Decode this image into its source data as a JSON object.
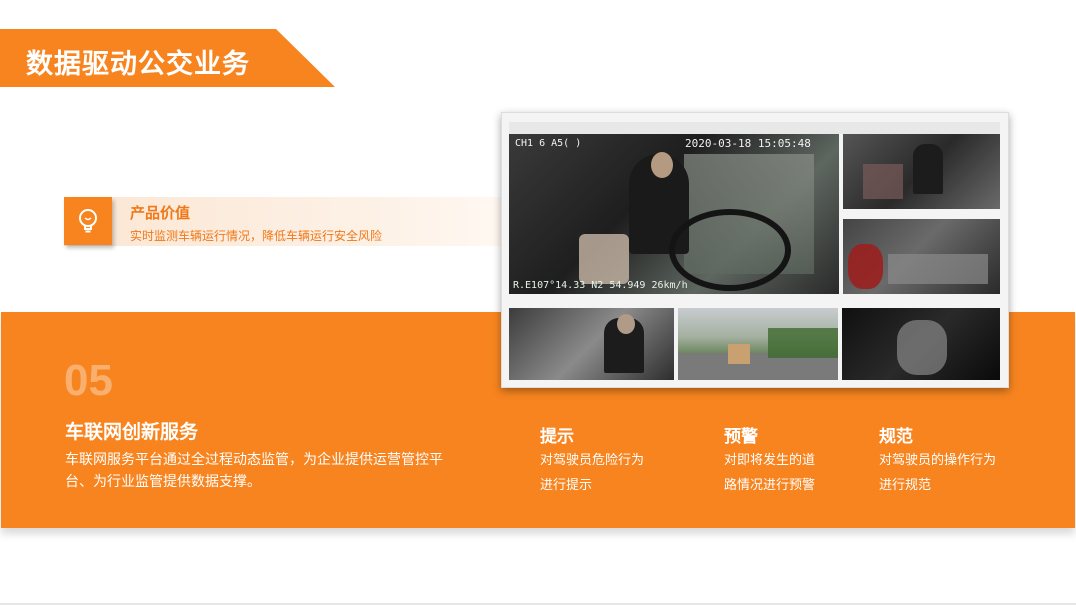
{
  "title": "数据驱动公交业务",
  "product_value": {
    "heading": "产品价值",
    "description": "实时监测车辆运行情况，降低车辆运行安全风险",
    "icon": "lightbulb-icon"
  },
  "service": {
    "number": "05",
    "title": "车联网创新服务",
    "description": "车联网服务平台通过全过程动态监管，为企业提供运营管控平台、为行业监管提供数据支撑。"
  },
  "features": [
    {
      "title": "提示",
      "lines": [
        "对驾驶员危险行为",
        "进行提示"
      ]
    },
    {
      "title": "预警",
      "lines": [
        "对即将发生的道",
        "路情况进行预警"
      ]
    },
    {
      "title": "规范",
      "lines": [
        "对驾驶员的操作行为",
        "进行规范"
      ]
    }
  ],
  "monitor": {
    "timestamp": "2020-03-18 15:05:48",
    "channel_label": "CH1 6 A5(  )",
    "gps_caption": "R.E107°14.33 N2   54.949 26km/h"
  },
  "colors": {
    "accent": "#F7841F",
    "accent_text": "#F07818"
  }
}
